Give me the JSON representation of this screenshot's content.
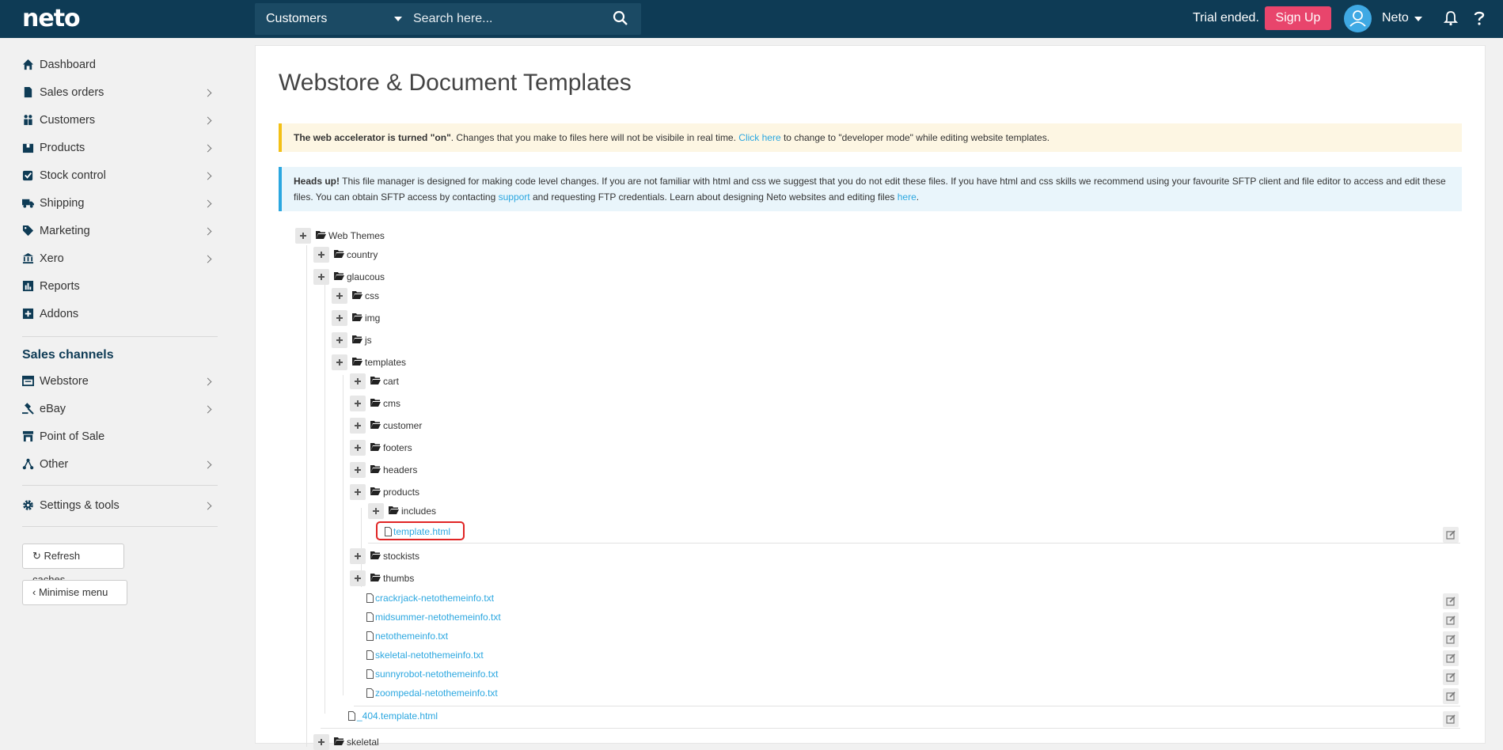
{
  "topbar": {
    "logo": "neto",
    "search_type": "Customers",
    "search_placeholder": "Search here...",
    "trial_text": "Trial ended.",
    "signup_label": "Sign Up",
    "user_name": "Neto"
  },
  "sidebar": {
    "items": [
      {
        "label": "Dashboard",
        "icon": "home-icon"
      },
      {
        "label": "Sales orders",
        "icon": "document-icon"
      },
      {
        "label": "Customers",
        "icon": "users-icon"
      },
      {
        "label": "Products",
        "icon": "box-icon"
      },
      {
        "label": "Stock control",
        "icon": "checkbox-icon"
      },
      {
        "label": "Shipping",
        "icon": "truck-icon"
      },
      {
        "label": "Marketing",
        "icon": "tags-icon"
      },
      {
        "label": "Xero",
        "icon": "bank-icon"
      },
      {
        "label": "Reports",
        "icon": "chart-icon"
      },
      {
        "label": "Addons",
        "icon": "plus-square-icon"
      }
    ],
    "channels_heading": "Sales channels",
    "channels": [
      {
        "label": "Webstore",
        "icon": "browser-icon"
      },
      {
        "label": "eBay",
        "icon": "gavel-icon"
      },
      {
        "label": "Point of Sale",
        "icon": "store-icon"
      },
      {
        "label": "Other",
        "icon": "sitemap-icon"
      }
    ],
    "settings_label": "Settings & tools",
    "refresh_label": "Refresh caches",
    "minimise_label": "Minimise menu"
  },
  "page": {
    "title": "Webstore & Document Templates",
    "warn_bold": "The web accelerator is turned \"on\"",
    "warn_text1": ". Changes that you make to files here will not be visibile in real time. ",
    "warn_link": "Click here",
    "warn_text2": " to change to \"developer mode\" while editing website templates.",
    "info_bold": "Heads up!",
    "info_text1": " This file manager is designed for making code level changes. If you are not familiar with html and css we suggest that you do not edit these files. If you have html and css skills we recommend using your favourite SFTP client and file editor to access and edit these files. You can obtain SFTP access by contacting ",
    "info_link1": "support",
    "info_text2": " and requesting FTP credentials. Learn about designing Neto websites and editing files ",
    "info_link2": "here",
    "info_text3": "."
  },
  "tree": {
    "root": "Web Themes",
    "country": "country",
    "glaucous": "glaucous",
    "css": "css",
    "img": "img",
    "js": "js",
    "templates": "templates",
    "cart": "cart",
    "cms": "cms",
    "customer": "customer",
    "footers": "footers",
    "headers": "headers",
    "products": "products",
    "includes": "includes",
    "template_html": "template.html",
    "stockists": "stockists",
    "thumbs": "thumbs",
    "files": [
      "crackrjack-netothemeinfo.txt",
      "midsummer-netothemeinfo.txt",
      "netothemeinfo.txt",
      "skeletal-netothemeinfo.txt",
      "sunnyrobot-netothemeinfo.txt",
      "zoompedal-netothemeinfo.txt"
    ],
    "file_404": "_404.template.html",
    "skeletal": "skeletal"
  }
}
